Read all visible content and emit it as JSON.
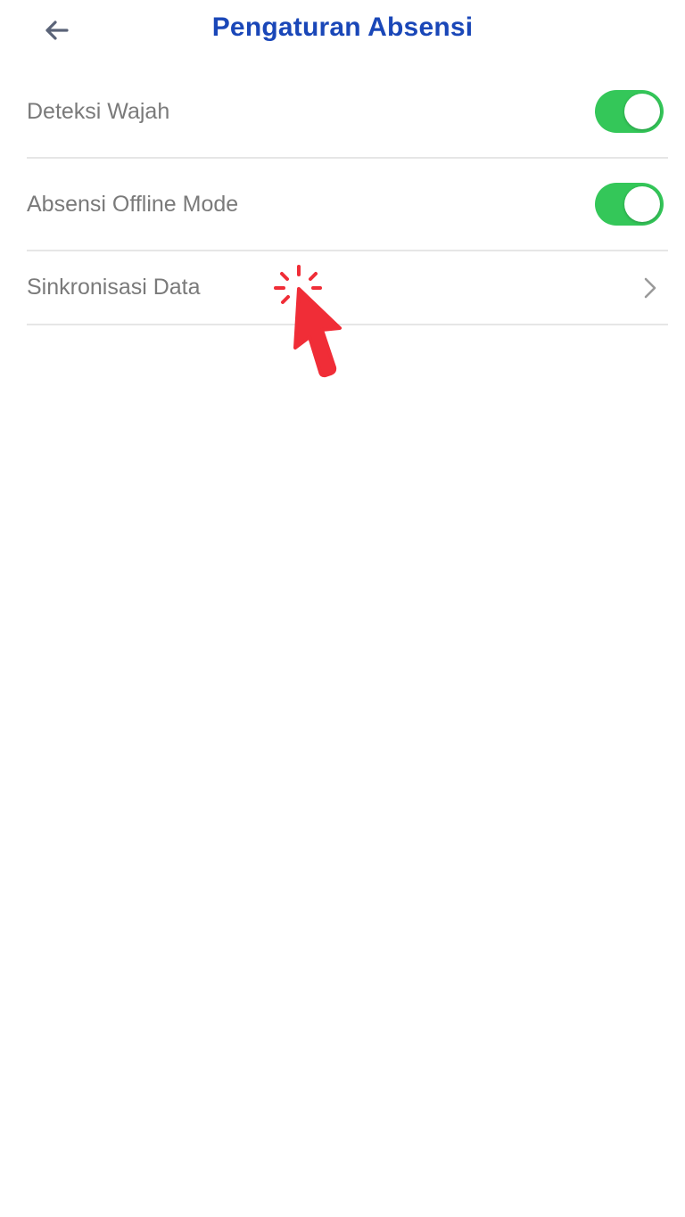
{
  "header": {
    "title": "Pengaturan Absensi",
    "back_icon": "arrow-left-icon"
  },
  "settings": [
    {
      "label": "Deteksi Wajah",
      "type": "toggle",
      "enabled": true
    },
    {
      "label": "Absensi Offline Mode",
      "type": "toggle",
      "enabled": true
    },
    {
      "label": "Sinkronisasi Data",
      "type": "navigation",
      "icon": "chevron-right-icon"
    }
  ],
  "colors": {
    "title": "#1a47b8",
    "toggle_on": "#34c759",
    "label": "#7a7a7a",
    "divider": "#e6e6e6",
    "back_icon": "#5a6378",
    "cursor": "#f02d37"
  }
}
